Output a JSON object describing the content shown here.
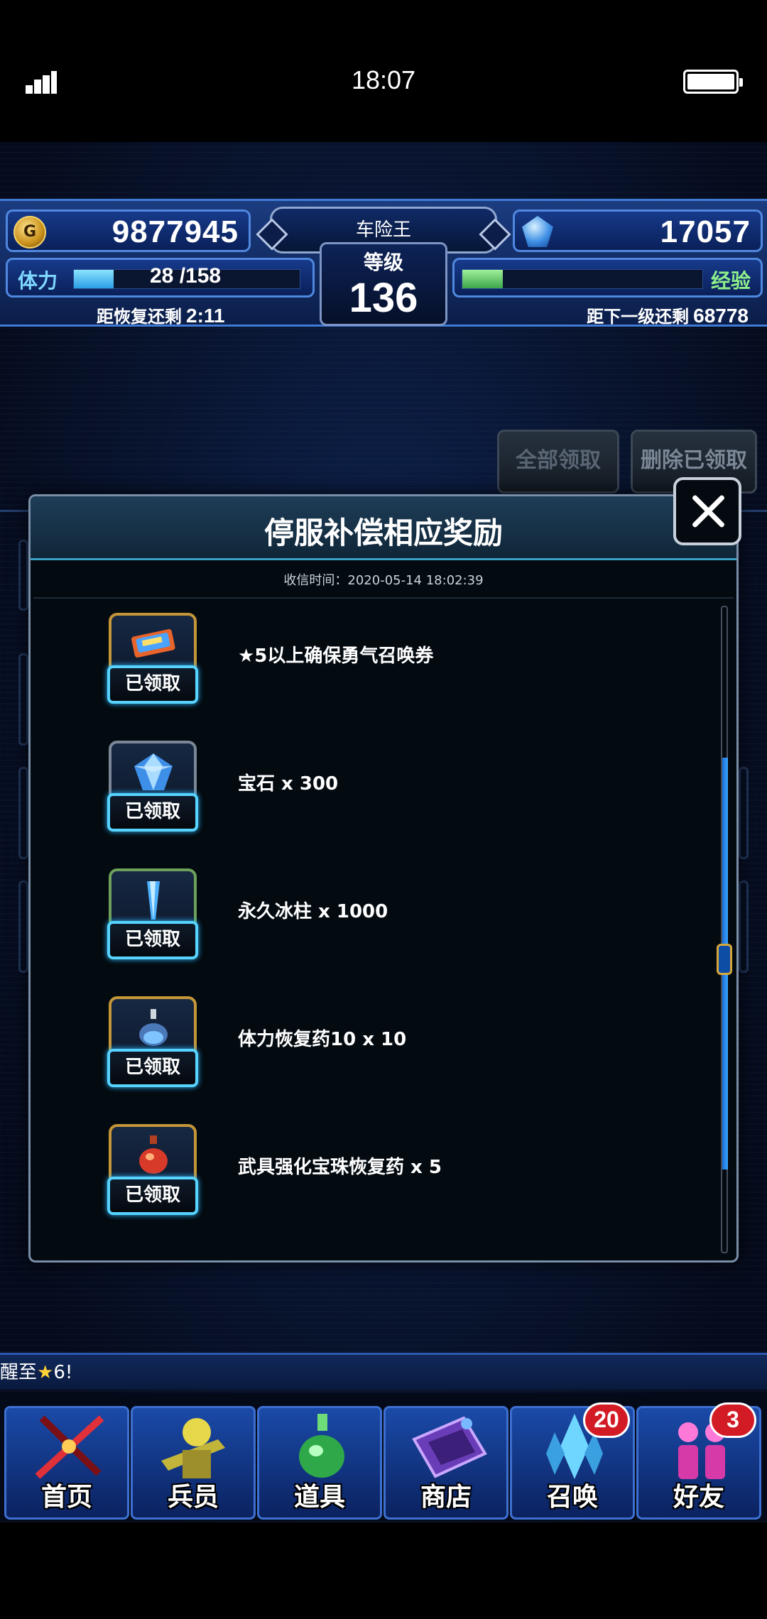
{
  "status_bar": {
    "time": "18:07"
  },
  "hud": {
    "coins": "9877945",
    "gems": "17057",
    "player_name": "车险王",
    "level_label": "等级",
    "level": "136",
    "stamina_label": "体力",
    "stamina_value": "28 /158",
    "stamina_fraction": 0.177,
    "recover_label": "距恢复还剩",
    "recover_time": "2:11",
    "exp_label": "经验",
    "exp_fraction": 0.17,
    "next_level_label": "距下一级还剩",
    "next_level_exp": "68778"
  },
  "background_buttons": {
    "claim_all": "全部领取",
    "delete_claimed": "删除已领取"
  },
  "modal": {
    "title": "停服补偿相应奖励",
    "received_time": "收信时间：2020-05-14 18:02:39",
    "items": [
      {
        "icon": "summon-ticket-icon",
        "badge": "已领取",
        "label": "★5以上确保勇气召唤券"
      },
      {
        "icon": "gem-icon",
        "badge": "已领取",
        "label": "宝石 x 300"
      },
      {
        "icon": "ice-pillar-icon",
        "badge": "已领取",
        "label": "永久冰柱 x 1000"
      },
      {
        "icon": "stamina-potion-icon",
        "badge": "已领取",
        "label": "体力恢复药10 x 10"
      },
      {
        "icon": "enhance-potion-icon",
        "badge": "已领取",
        "label": "武具强化宝珠恢复药 x 5"
      }
    ]
  },
  "ticker": {
    "prefix": "醒至",
    "star": "★",
    "suffix": "6!"
  },
  "nav": [
    {
      "label": "首页",
      "icon": "sword-icon"
    },
    {
      "label": "兵员",
      "icon": "soldier-icon"
    },
    {
      "label": "道具",
      "icon": "potion-icon"
    },
    {
      "label": "商店",
      "icon": "shop-icon"
    },
    {
      "label": "召唤",
      "icon": "crystal-icon",
      "badge": "20"
    },
    {
      "label": "好友",
      "icon": "friends-icon",
      "badge": "3"
    }
  ]
}
